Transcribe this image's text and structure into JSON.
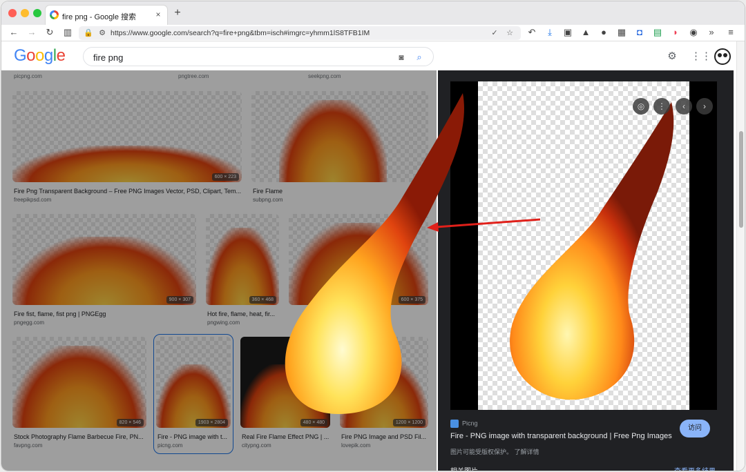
{
  "browser": {
    "tab_title": "fire png - Google 搜索",
    "tab_close": "×",
    "new_tab": "+",
    "url": "https://www.google.com/search?q=fire+png&tbm=isch#imgrc=yhmm1lS8TFB1IM"
  },
  "google": {
    "logo": "Google",
    "query": "fire png"
  },
  "results": {
    "top_captions": [
      {
        "src": "picpng.com"
      },
      {
        "src": "pngtree.com"
      },
      {
        "src": "seekpng.com"
      }
    ],
    "items": [
      {
        "caption": "Fire Png Transparent Background – Free PNG Images Vector, PSD, Clipart, Tem...",
        "source": "freepikpsd.com",
        "dims": "600 × 223"
      },
      {
        "caption": "Fire Flame",
        "source": "subpng.com",
        "dims": ""
      },
      {
        "caption": "Fire fist, flame, fist png | PNGEgg",
        "source": "pngegg.com",
        "dims": "900 × 307"
      },
      {
        "caption": "Hot fire, flame, heat, fir...",
        "source": "pngwing.com",
        "dims": "360 × 468"
      },
      {
        "caption": "",
        "source": "",
        "dims": "600 × 375"
      },
      {
        "caption": "Stock Photography Flame Barbecue Fire, PN...",
        "source": "favpng.com",
        "dims": "820 × 546"
      },
      {
        "caption": "Fire - PNG image with t...",
        "source": "picng.com",
        "dims": "1903 × 2804"
      },
      {
        "caption": "Real Fire Flame Effect PNG | ...",
        "source": "citypng.com",
        "dims": "480 × 480"
      },
      {
        "caption": "Fire PNG Image and PSD Fil...",
        "source": "lovepik.com",
        "dims": "1200 × 1200"
      }
    ]
  },
  "panel": {
    "site": "Picng",
    "title": "Fire - PNG image with transparent background | Free Png Images",
    "note": "图片可能受版权保护。 了解详情",
    "visit": "访问",
    "related": "相关图片",
    "more": "查看更多结果"
  }
}
